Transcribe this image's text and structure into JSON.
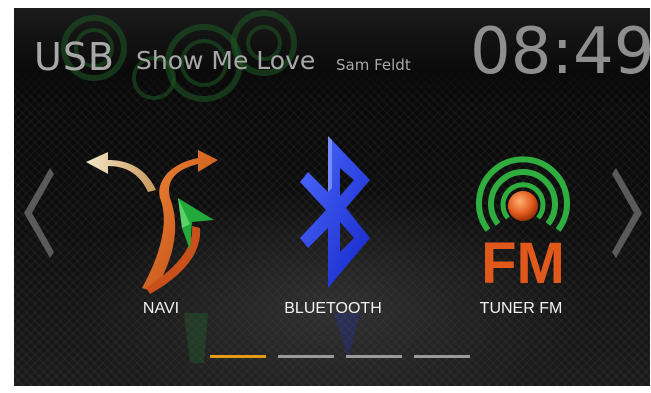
{
  "header": {
    "source": "USB",
    "track_title": "Show Me Love",
    "artist": "Sam Feldt",
    "clock": "08:49"
  },
  "apps": [
    {
      "label": "NAVI",
      "icon": "navigation-arrows-icon"
    },
    {
      "label": "BLUETOOTH",
      "icon": "bluetooth-icon"
    },
    {
      "label": "TUNER FM",
      "icon": "fm-radio-icon"
    }
  ],
  "navigation": {
    "prev_icon": "chevron-left-icon",
    "next_icon": "chevron-right-icon"
  },
  "pager": {
    "page_count": 4,
    "active_page": 1
  },
  "colors": {
    "accent_orange": "#e49a12",
    "bluetooth_blue": "#1f3cff",
    "fm_green": "#2fae3f",
    "fm_orange": "#e0581c",
    "navi_green": "#23a83a"
  }
}
